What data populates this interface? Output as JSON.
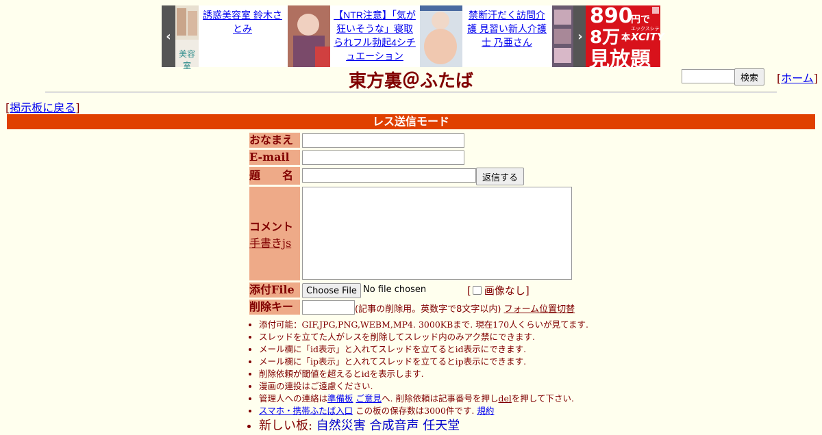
{
  "ads": {
    "prev_arrow": "‹",
    "next_arrow": "›",
    "items": [
      {
        "text": "誘惑美容室 鈴木さとみ",
        "thumb_label": "美容室"
      },
      {
        "text": "【NTR注意】「気が狂いそうな」寝取られフル勃起4シチュエーション"
      },
      {
        "text": "禁断汗だく訪問介護 見習い新人介護士 乃亜さん"
      }
    ],
    "banner": {
      "price": "890",
      "price_unit": "円で",
      "count": "8万",
      "count_unit": "本",
      "brand": "XCITY",
      "brand_kana": "エックスシティ",
      "tagline": "見放題"
    }
  },
  "header": {
    "title": "東方裏＠ふたば",
    "search_button": "検索",
    "home_link": "ホーム",
    "back_link": "掲示板に戻る"
  },
  "mode_bar": "レス送信モード",
  "form": {
    "name_label": "おなまえ",
    "email_label": "E-mail",
    "subject_label": "題　　名",
    "submit_label": "返信する",
    "comment_label": "コメント",
    "handwrite_link": "手書きjs",
    "file_label": "添付File",
    "file_button": "Choose File",
    "file_status": "No file chosen",
    "noimg_label": "画像なし",
    "delkey_label": "削除キー",
    "delkey_note": "(記事の削除用。英数字で8文字以内)",
    "form_toggle_link": "フォーム位置切替"
  },
  "rules": {
    "r1": "添付可能：GIF,JPG,PNG,WEBM,MP4. 3000KBまで. 現在170人くらいが見てます.",
    "r2": "スレッドを立てた人がレスを削除してスレッド内のみアク禁にできます.",
    "r3": "メール欄に「id表示」と入れてスレッドを立てるとid表示にできます.",
    "r4": "メール欄に「ip表示」と入れてスレッドを立てるとip表示にできます.",
    "r5": "削除依頼が閾値を超えるとidを表示します.",
    "r6": "漫画の連投はご遠慮ください.",
    "r7_prefix": "管理人への連絡は",
    "r7_link1": "準備板",
    "r7_link2": "ご意見",
    "r7_middle": "へ. 削除依頼は記事番号を押し",
    "r7_del": "del",
    "r7_suffix": "を押して下さい.",
    "r8_link": "スマホ・携帯ふたば入口",
    "r8_middle": " この板の保存数は3000件です. ",
    "r8_link2": "規約",
    "r9_prefix": "新しい板: ",
    "r9_boards": [
      "自然災害",
      "合成音声",
      "任天堂"
    ]
  }
}
